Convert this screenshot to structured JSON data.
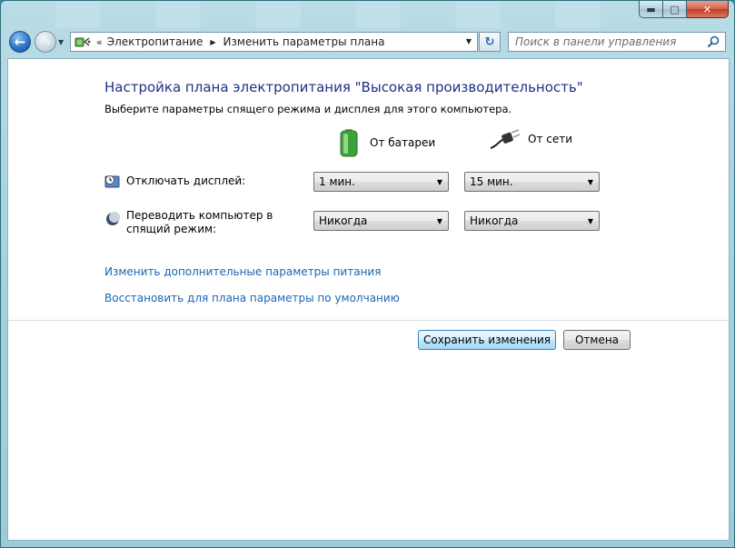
{
  "window": {
    "caption": {
      "minimize": "▬",
      "maximize": "□",
      "close": "✕"
    }
  },
  "nav": {
    "back_icon": "back-arrow-icon",
    "forward_icon": "forward-arrow-icon"
  },
  "address": {
    "chevron": "«",
    "crumbs": [
      "Электропитание",
      "Изменить параметры плана"
    ]
  },
  "search": {
    "placeholder": "Поиск в панели управления"
  },
  "page": {
    "title": "Настройка плана электропитания \"Высокая производительность\"",
    "subtitle": "Выберите параметры спящего режима и дисплея для этого компьютера."
  },
  "columns": {
    "battery": "От батареи",
    "power": "От сети"
  },
  "settings": [
    {
      "label": "Отключать дисплей:",
      "battery": "1 мин.",
      "power": "15 мин."
    },
    {
      "label": "Переводить компьютер в спящий режим:",
      "battery": "Никогда",
      "power": "Никогда"
    }
  ],
  "links": {
    "advanced": "Изменить дополнительные параметры питания",
    "restore": "Восстановить для плана параметры по умолчанию"
  },
  "buttons": {
    "save": "Сохранить изменения",
    "cancel": "Отмена"
  },
  "colors": {
    "title": "#1e3287",
    "link": "#1a65b4",
    "accent": "#3c7fb1"
  }
}
